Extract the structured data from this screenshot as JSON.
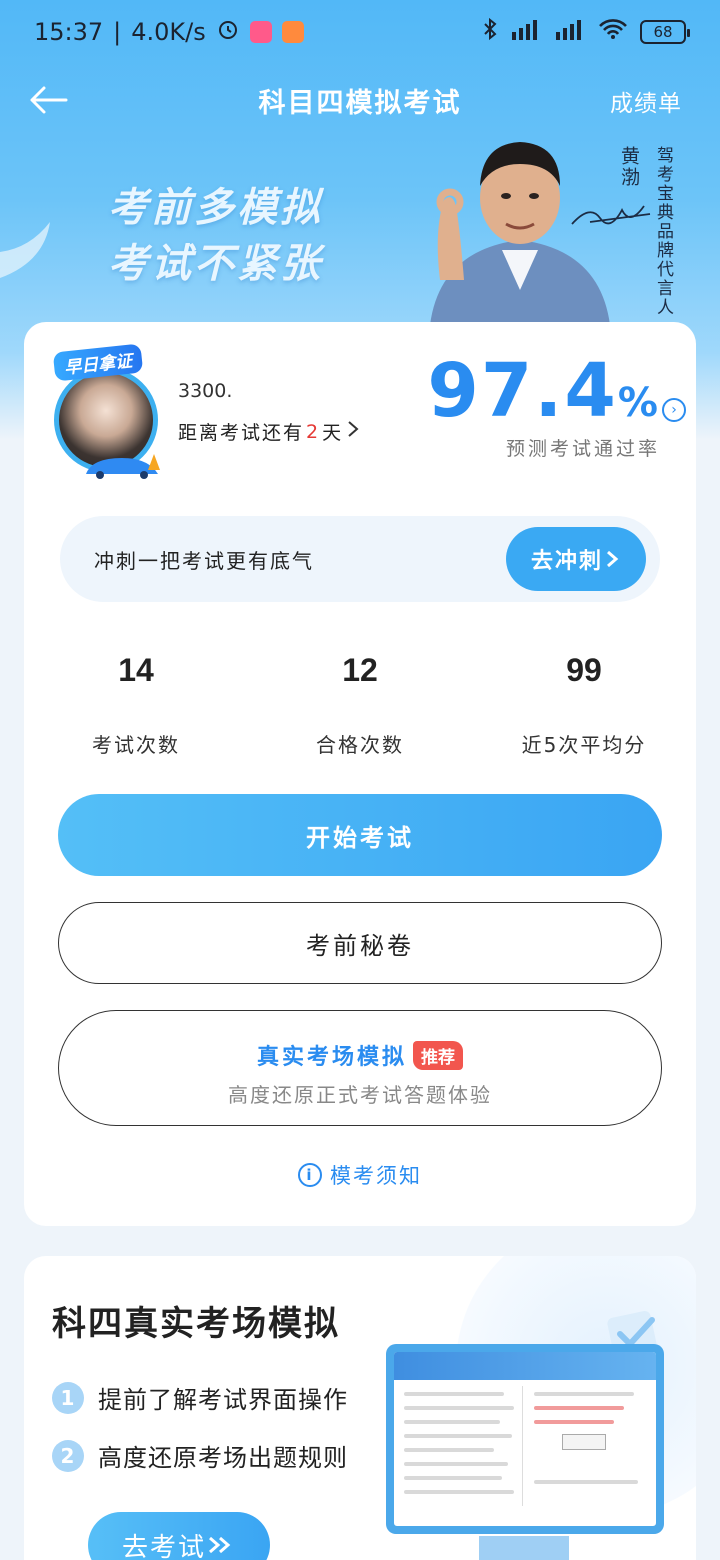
{
  "status_bar": {
    "time": "15:37",
    "speed": "4.0K/s",
    "battery": "68"
  },
  "nav": {
    "title": "科目四模拟考试",
    "right_label": "成绩单"
  },
  "banner": {
    "slogan_line1": "考前多模拟",
    "slogan_line2": "考试不紧张",
    "endorser_name": "黄渤",
    "endorser_title": "驾考宝典品牌代言人"
  },
  "profile": {
    "badge": "早日拿证",
    "username": "3300.",
    "countdown_prefix": "距离考试还有",
    "countdown_days": "2",
    "countdown_suffix": "天"
  },
  "prediction": {
    "rate_value": "97.4",
    "rate_unit": "%",
    "label": "预测考试通过率"
  },
  "sprint": {
    "text": "冲刺一把考试更有底气",
    "button": "去冲刺"
  },
  "stats": [
    {
      "value": "14",
      "label": "考试次数"
    },
    {
      "value": "12",
      "label": "合格次数"
    },
    {
      "value": "99",
      "label": "近5次平均分"
    }
  ],
  "actions": {
    "start_exam": "开始考试",
    "secret_paper": "考前秘卷",
    "real_sim_title": "真实考场模拟",
    "real_sim_badge": "推荐",
    "real_sim_sub": "高度还原正式考试答题体验",
    "notice": "模考须知"
  },
  "real_section": {
    "title": "科四真实考场模拟",
    "features": [
      {
        "num": "1",
        "text": "提前了解考试界面操作"
      },
      {
        "num": "2",
        "text": "高度还原考场出题规则"
      }
    ],
    "button": "去考试"
  },
  "colors": {
    "primary": "#3aa5f3",
    "accent_blue": "#2a8cf0",
    "red": "#e53935",
    "badge_red": "#f2564e"
  }
}
